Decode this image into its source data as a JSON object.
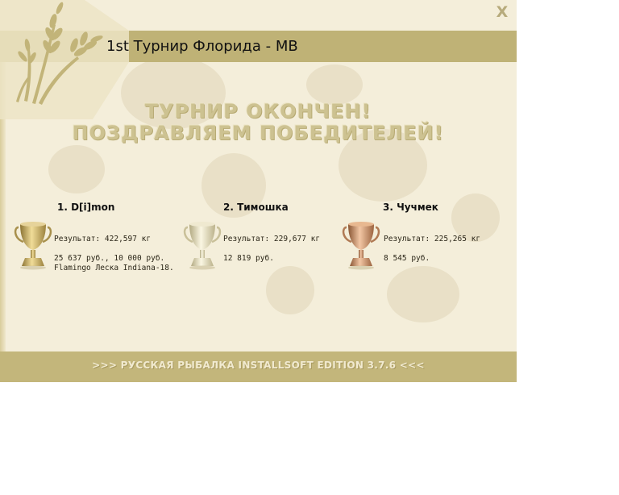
{
  "window": {
    "close_label": "X",
    "title": "1st Турнир Флорида - MB"
  },
  "headline": {
    "line1": "ТУРНИР ОКОНЧЕН!",
    "line2": "ПОЗДРАВЛЯЕМ ПОБЕДИТЕЛЕЙ!"
  },
  "winners": [
    {
      "place_name": "1. D[i]mon",
      "result": "Результат: 422,597 кг",
      "prize_line1": "25 637 руб., 10 000 руб.",
      "prize_line2": "Flamingo Леска Indiana-18.",
      "trophy_icon": "gold-cup-icon"
    },
    {
      "place_name": "2. Тимошка",
      "result": "Результат: 229,677 кг",
      "prize_line1": "12 819 руб.",
      "trophy_icon": "silver-cup-icon"
    },
    {
      "place_name": "3. Чучмек",
      "result": "Результат: 225,265 кг",
      "prize_line1": "8 545 руб.",
      "trophy_icon": "bronze-cup-icon"
    }
  ],
  "footer": {
    "text": ">>> РУССКАЯ РЫБАЛКА INSTALLSOFT EDITION 3.7.6 <<<"
  },
  "colors": {
    "background": "#f4eeda",
    "bar": "#bfb276",
    "gold": "#cdb060",
    "silver": "#d4cca8",
    "bronze": "#c48a62"
  }
}
